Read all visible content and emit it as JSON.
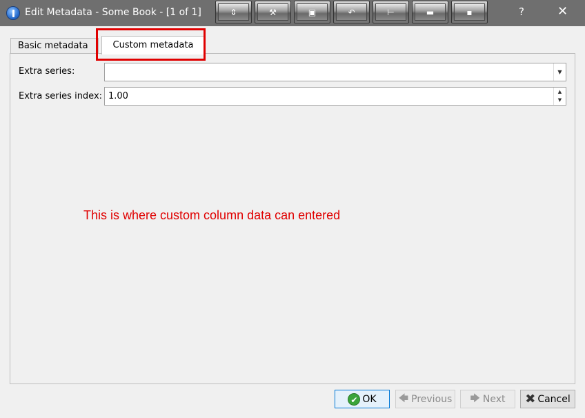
{
  "window": {
    "title": "Edit Metadata - Some Book -  [1 of 1]",
    "help_label": "?",
    "close_label": "✕",
    "toolbar_buttons": [
      {
        "icon": "spread-vertical-icon",
        "glyph": "⇕"
      },
      {
        "icon": "wrench-icon",
        "glyph": "⚒"
      },
      {
        "icon": "frame-icon",
        "glyph": "▣"
      },
      {
        "icon": "undo-icon",
        "glyph": "↶"
      },
      {
        "icon": "pin-icon",
        "glyph": "⊢"
      },
      {
        "icon": "minimize-icon",
        "glyph": "▬"
      },
      {
        "icon": "small-square-icon",
        "glyph": "▪"
      }
    ]
  },
  "tabs": {
    "basic": "Basic metadata",
    "custom": "Custom metadata",
    "active": "custom"
  },
  "fields": {
    "extra_series_label": "Extra series:",
    "extra_series_value": "",
    "extra_series_index_label": "Extra series index:",
    "extra_series_index_value": "1.00"
  },
  "annotation": "This is where custom column data can entered",
  "buttons": {
    "ok": "OK",
    "previous": "Previous",
    "next": "Next",
    "cancel": "Cancel"
  },
  "colors": {
    "annotation": "#e00000",
    "titlebar": "#6f6f6f"
  }
}
